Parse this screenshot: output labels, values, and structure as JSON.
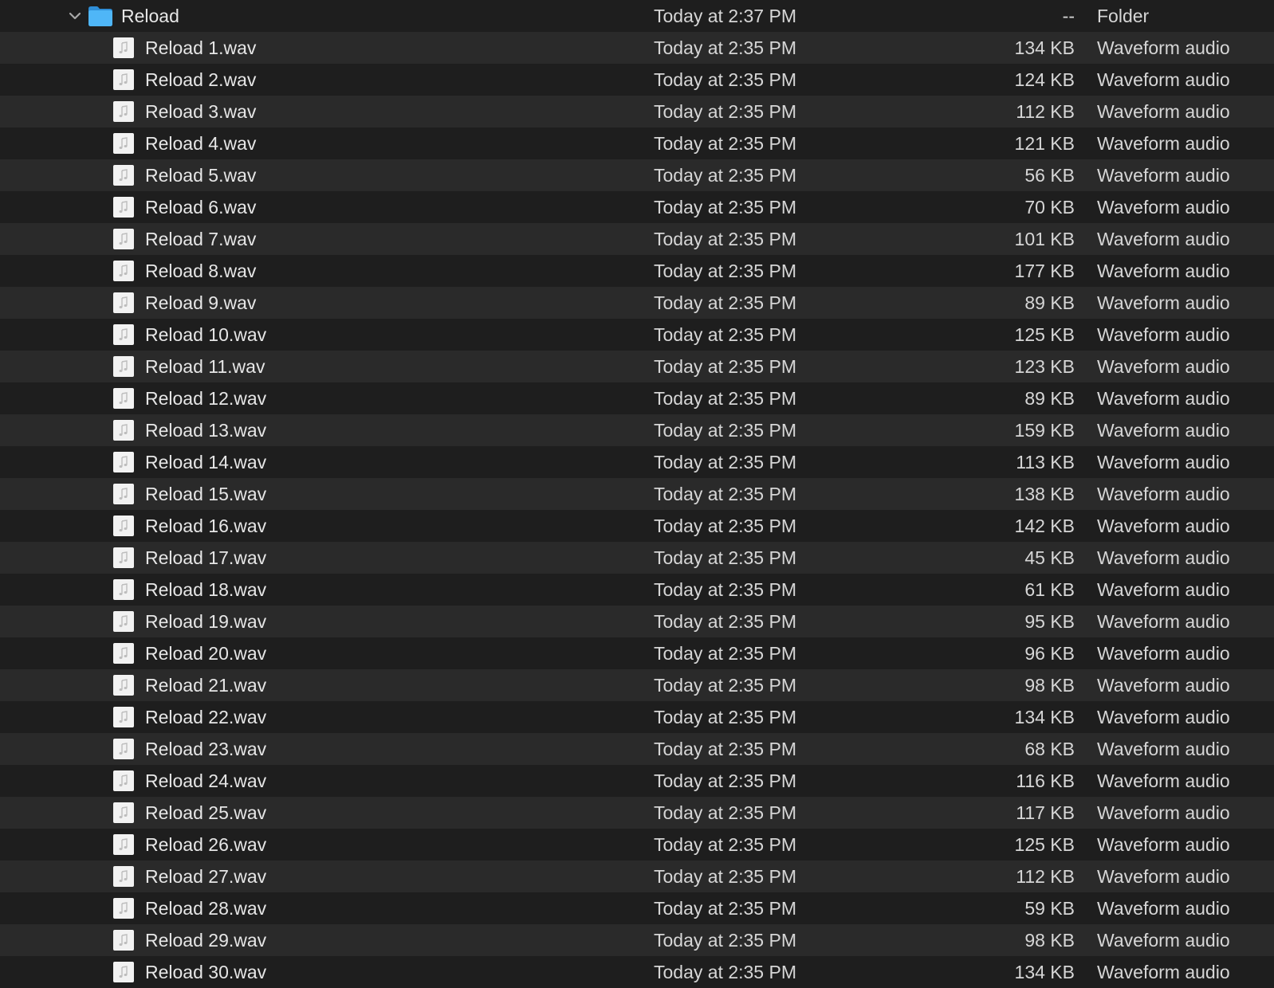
{
  "folder": {
    "name": "Reload",
    "date": "Today at 2:37 PM",
    "size": "--",
    "kind": "Folder"
  },
  "files": [
    {
      "name": "Reload 1.wav",
      "date": "Today at 2:35 PM",
      "size": "134 KB",
      "kind": "Waveform audio"
    },
    {
      "name": "Reload 2.wav",
      "date": "Today at 2:35 PM",
      "size": "124 KB",
      "kind": "Waveform audio"
    },
    {
      "name": "Reload 3.wav",
      "date": "Today at 2:35 PM",
      "size": "112 KB",
      "kind": "Waveform audio"
    },
    {
      "name": "Reload 4.wav",
      "date": "Today at 2:35 PM",
      "size": "121 KB",
      "kind": "Waveform audio"
    },
    {
      "name": "Reload 5.wav",
      "date": "Today at 2:35 PM",
      "size": "56 KB",
      "kind": "Waveform audio"
    },
    {
      "name": "Reload 6.wav",
      "date": "Today at 2:35 PM",
      "size": "70 KB",
      "kind": "Waveform audio"
    },
    {
      "name": "Reload 7.wav",
      "date": "Today at 2:35 PM",
      "size": "101 KB",
      "kind": "Waveform audio"
    },
    {
      "name": "Reload 8.wav",
      "date": "Today at 2:35 PM",
      "size": "177 KB",
      "kind": "Waveform audio"
    },
    {
      "name": "Reload 9.wav",
      "date": "Today at 2:35 PM",
      "size": "89 KB",
      "kind": "Waveform audio"
    },
    {
      "name": "Reload 10.wav",
      "date": "Today at 2:35 PM",
      "size": "125 KB",
      "kind": "Waveform audio"
    },
    {
      "name": "Reload 11.wav",
      "date": "Today at 2:35 PM",
      "size": "123 KB",
      "kind": "Waveform audio"
    },
    {
      "name": "Reload 12.wav",
      "date": "Today at 2:35 PM",
      "size": "89 KB",
      "kind": "Waveform audio"
    },
    {
      "name": "Reload 13.wav",
      "date": "Today at 2:35 PM",
      "size": "159 KB",
      "kind": "Waveform audio"
    },
    {
      "name": "Reload 14.wav",
      "date": "Today at 2:35 PM",
      "size": "113 KB",
      "kind": "Waveform audio"
    },
    {
      "name": "Reload 15.wav",
      "date": "Today at 2:35 PM",
      "size": "138 KB",
      "kind": "Waveform audio"
    },
    {
      "name": "Reload 16.wav",
      "date": "Today at 2:35 PM",
      "size": "142 KB",
      "kind": "Waveform audio"
    },
    {
      "name": "Reload 17.wav",
      "date": "Today at 2:35 PM",
      "size": "45 KB",
      "kind": "Waveform audio"
    },
    {
      "name": "Reload 18.wav",
      "date": "Today at 2:35 PM",
      "size": "61 KB",
      "kind": "Waveform audio"
    },
    {
      "name": "Reload 19.wav",
      "date": "Today at 2:35 PM",
      "size": "95 KB",
      "kind": "Waveform audio"
    },
    {
      "name": "Reload 20.wav",
      "date": "Today at 2:35 PM",
      "size": "96 KB",
      "kind": "Waveform audio"
    },
    {
      "name": "Reload 21.wav",
      "date": "Today at 2:35 PM",
      "size": "98 KB",
      "kind": "Waveform audio"
    },
    {
      "name": "Reload 22.wav",
      "date": "Today at 2:35 PM",
      "size": "134 KB",
      "kind": "Waveform audio"
    },
    {
      "name": "Reload 23.wav",
      "date": "Today at 2:35 PM",
      "size": "68 KB",
      "kind": "Waveform audio"
    },
    {
      "name": "Reload 24.wav",
      "date": "Today at 2:35 PM",
      "size": "116 KB",
      "kind": "Waveform audio"
    },
    {
      "name": "Reload 25.wav",
      "date": "Today at 2:35 PM",
      "size": "117 KB",
      "kind": "Waveform audio"
    },
    {
      "name": "Reload 26.wav",
      "date": "Today at 2:35 PM",
      "size": "125 KB",
      "kind": "Waveform audio"
    },
    {
      "name": "Reload 27.wav",
      "date": "Today at 2:35 PM",
      "size": "112 KB",
      "kind": "Waveform audio"
    },
    {
      "name": "Reload 28.wav",
      "date": "Today at 2:35 PM",
      "size": "59 KB",
      "kind": "Waveform audio"
    },
    {
      "name": "Reload 29.wav",
      "date": "Today at 2:35 PM",
      "size": "98 KB",
      "kind": "Waveform audio"
    },
    {
      "name": "Reload 30.wav",
      "date": "Today at 2:35 PM",
      "size": "134 KB",
      "kind": "Waveform audio"
    }
  ],
  "icons": {
    "folder": "folder-icon",
    "file": "audio-file-icon",
    "disclosure": "chevron-down-icon"
  },
  "colors": {
    "background": "#1e1e1e",
    "alt_row": "#2a2a2a",
    "folder_blue": "#3fa9f5",
    "text": "#e6e6e6"
  }
}
